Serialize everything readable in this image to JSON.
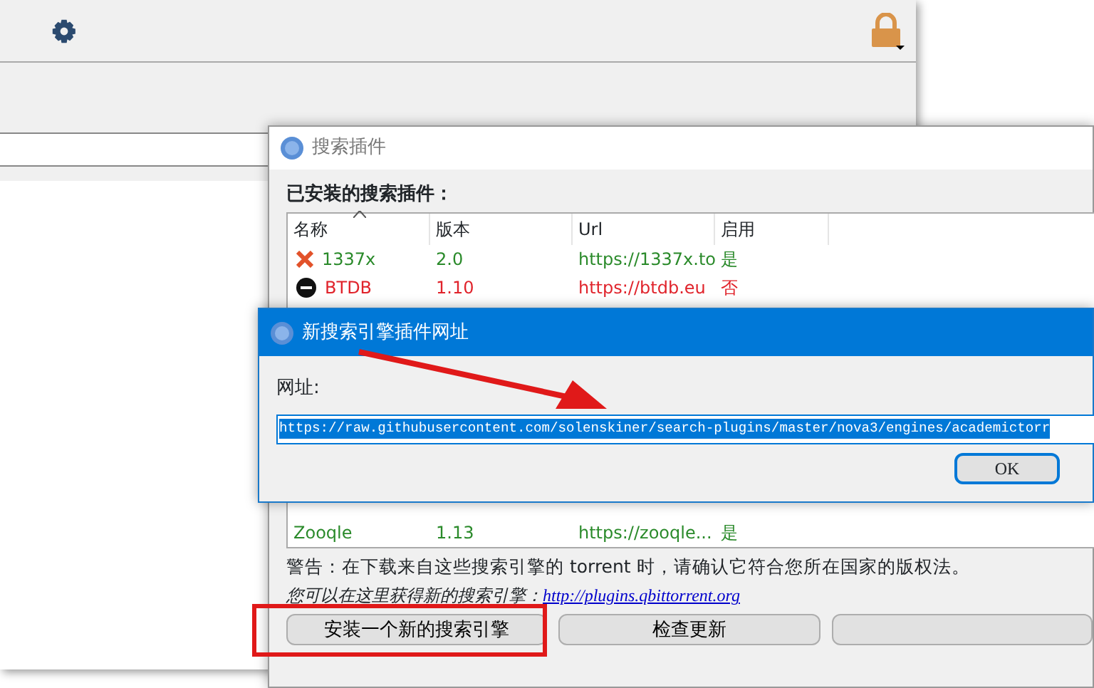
{
  "plugin_dialog": {
    "title": "搜索插件",
    "installed_label": "已安装的搜索插件：",
    "table": {
      "columns": [
        "名称",
        "版本",
        "Url",
        "启用"
      ],
      "rows": [
        {
          "kind": "x-logo",
          "name": "1337x",
          "version": "2.0",
          "url": "https://1337x.to",
          "enabled_text": "是",
          "enabled": true
        },
        {
          "kind": "disc-logo",
          "name": "BTDB",
          "version": "1.10",
          "url": "https://btdb.eu",
          "enabled_text": "否",
          "enabled": false
        },
        {
          "kind": "none",
          "name": "Zooqle",
          "version": "1.13",
          "url": "https://zooqle...",
          "enabled_text": "是",
          "enabled": true
        }
      ]
    },
    "warning": "警告：在下载来自这些搜索引擎的 torrent 时，请确认它符合您所在国家的版权法。",
    "hint": "您可以在这里获得新的搜索引擎：",
    "link": "http://plugins.qbittorrent.org",
    "buttons": [
      "安装一个新的搜索引擎",
      "检查更新"
    ]
  },
  "url_dialog": {
    "title": "新搜索引擎插件网址",
    "label": "网址:",
    "value": "https://raw.githubusercontent.com/solenskiner/search-plugins/master/nova3/engines/academictorr",
    "buttons": [
      "OK"
    ]
  }
}
